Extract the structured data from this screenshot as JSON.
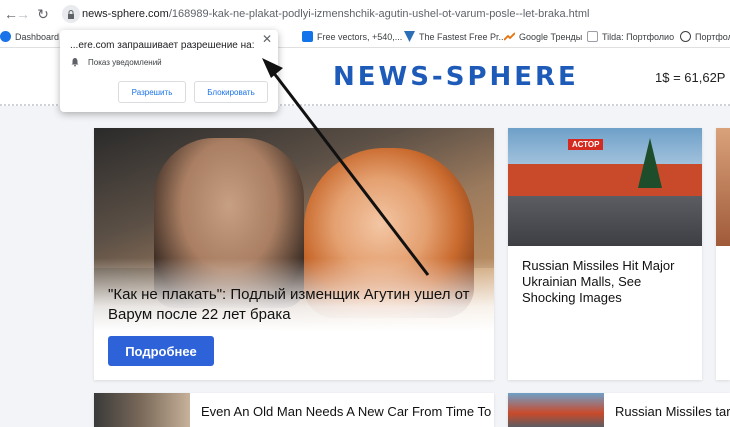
{
  "browser": {
    "url_host": "news-sphere.com",
    "url_path": "/168989-kak-ne-plakat-podlyi-izmenshchik-agutin-ushel-ot-varum-posle--let-braka.html"
  },
  "bookmarks": [
    {
      "label": "Dashboard |",
      "icon": "globe-icon"
    },
    {
      "label": "Free vectors, +540,...",
      "icon": "freepik-icon"
    },
    {
      "label": "The Fastest Free Pr...",
      "icon": "vpn-icon"
    },
    {
      "label": "Google Тренды",
      "icon": "trends-icon"
    },
    {
      "label": "Tilda: Портфолио",
      "icon": "tilda-icon"
    },
    {
      "label": "Портфол",
      "icon": "portfolio-icon"
    }
  ],
  "permission_popup": {
    "title": "...ere.com запрашивает разрешение на:",
    "item": "Показ уведомлений",
    "allow": "Разрешить",
    "block": "Блокировать"
  },
  "header": {
    "logo": "NEWS-SPHERE",
    "rate": "1$ = 61,62Р"
  },
  "hero": {
    "title": "\"Как не плакать\": Подлый изменщик Агутин ушел от Варум после 22 лет брака",
    "button": "Подробнее"
  },
  "cards": [
    {
      "title": "Russian Missiles Hit Major Ukrainian Malls, See Shocking Images",
      "store_sign": "АСТОР"
    },
    {
      "title": "Even An Old Man Needs A New Car From Time To Ti..."
    },
    {
      "title": "Russian Missiles targ..."
    }
  ]
}
